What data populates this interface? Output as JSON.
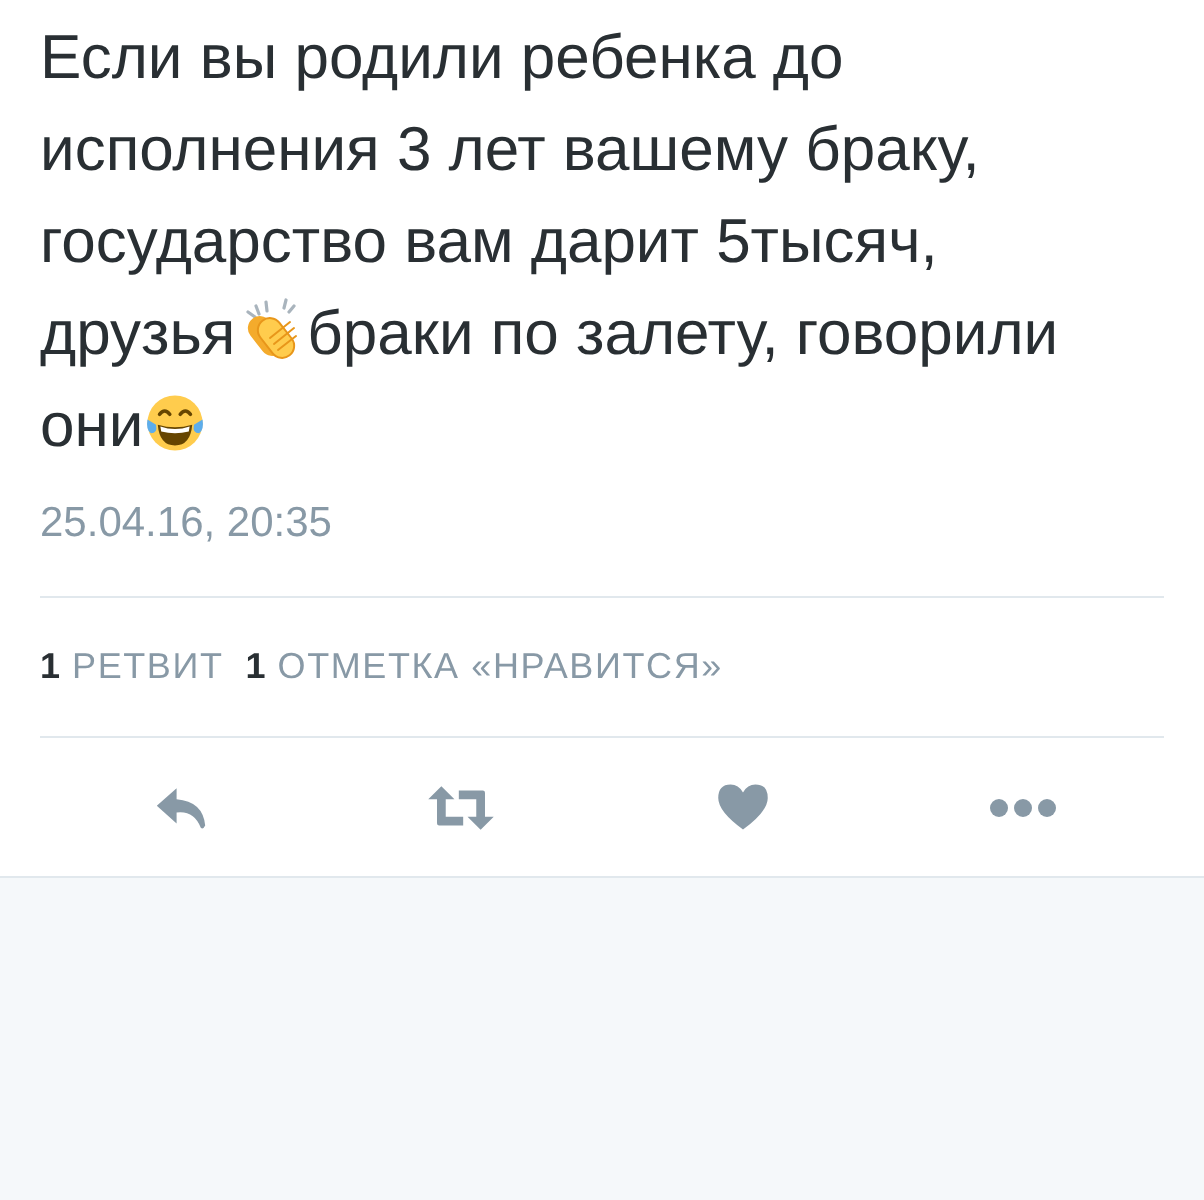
{
  "tweet": {
    "body_lines": [
      [
        {
          "kind": "text",
          "text": "Если вы родили ребенка до"
        }
      ],
      [
        {
          "kind": "text",
          "text": "исполнения 3 лет вашему браку,"
        }
      ],
      [
        {
          "kind": "text",
          "text": "государство вам дарит 5тысяч,"
        }
      ],
      [
        {
          "kind": "text",
          "text": "друзья"
        },
        {
          "kind": "clap"
        },
        {
          "kind": "text",
          "text": "браки по залету, говорили"
        }
      ],
      [
        {
          "kind": "text",
          "text": "они"
        },
        {
          "kind": "laugh"
        }
      ]
    ],
    "timestamp": "25.04.16, 20:35",
    "stats": [
      {
        "count": "1",
        "label": "РЕТВИТ"
      },
      {
        "count": "1",
        "label": "ОТМЕТКА «НРАВИТСЯ»"
      }
    ]
  }
}
